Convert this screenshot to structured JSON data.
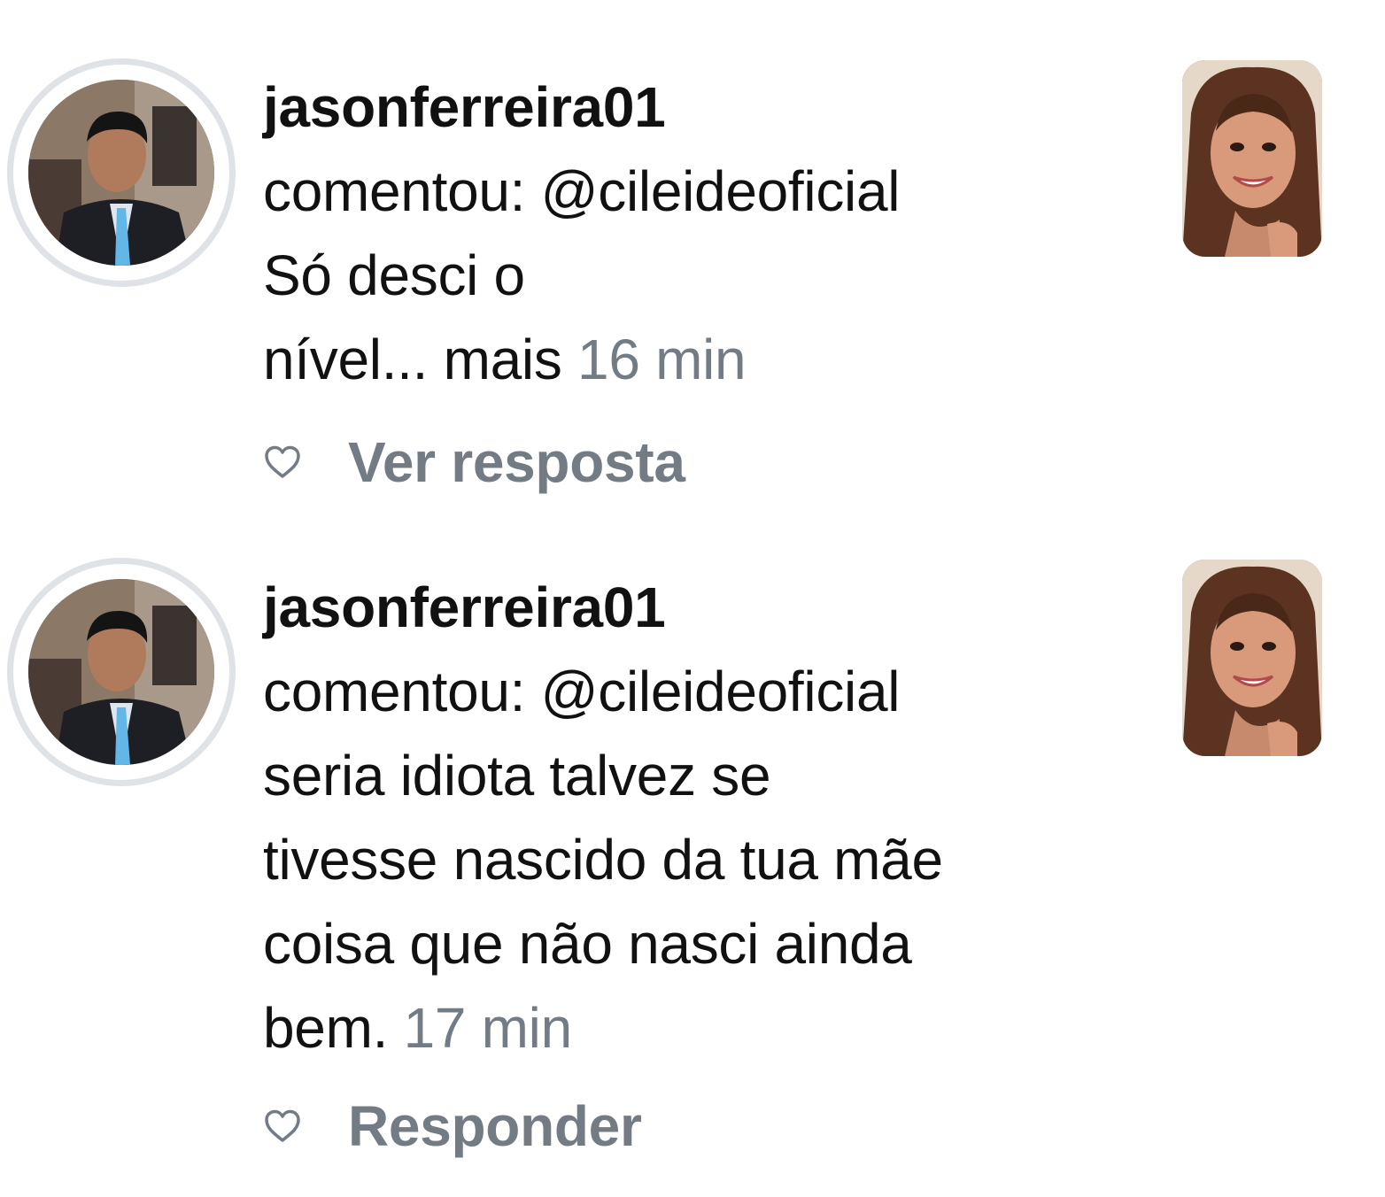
{
  "notifications": [
    {
      "avatar_icon": "user-avatar-photo",
      "username": "jasonferreira01",
      "lines": [
        "comentou: @cileideoficial",
        "Só desci o"
      ],
      "last_line": "nível... mais",
      "time": "16 min",
      "action": "Ver resposta",
      "thumbnail_icon": "post-thumbnail-photo"
    },
    {
      "avatar_icon": "user-avatar-photo",
      "username": "jasonferreira01",
      "lines": [
        "comentou: @cileideoficial",
        "seria idiota talvez se",
        "tivesse nascido da tua mãe",
        "coisa que não nasci ainda"
      ],
      "last_line": "bem.",
      "time": "17 min",
      "action": "Responder",
      "thumbnail_icon": "post-thumbnail-photo"
    }
  ],
  "colors": {
    "text": "#111111",
    "muted": "#737b85",
    "story_ring": "#dfe2e6",
    "background": "#ffffff"
  }
}
